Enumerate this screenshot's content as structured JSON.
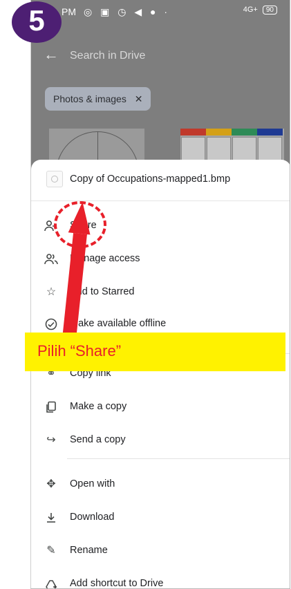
{
  "status_bar": {
    "time": "PM",
    "icons": "◎ ▣ ◷ ◀ ●  ·",
    "network": "4G+",
    "battery": "90"
  },
  "search": {
    "placeholder": "Search in Drive"
  },
  "filter_chip": {
    "label": "Photos & images",
    "close": "✕"
  },
  "sheet": {
    "file_name": "Copy of Occupations-mapped1.bmp",
    "items": [
      {
        "label": "Share",
        "icon": "person-add-icon"
      },
      {
        "label": "Manage access",
        "icon": "people-icon"
      },
      {
        "label": "Add to Starred",
        "icon": "star-icon"
      },
      {
        "label": "Make available offline",
        "icon": "offline-icon"
      },
      {
        "label": "Copy link",
        "icon": "link-icon"
      },
      {
        "label": "Make a copy",
        "icon": "copy-icon"
      },
      {
        "label": "Send a copy",
        "icon": "send-icon"
      },
      {
        "label": "Open with",
        "icon": "open-with-icon"
      },
      {
        "label": "Download",
        "icon": "download-icon"
      },
      {
        "label": "Rename",
        "icon": "rename-icon"
      },
      {
        "label": "Add shortcut to Drive",
        "icon": "shortcut-icon"
      }
    ]
  },
  "annotation": {
    "step_number": "5",
    "callout": "Pilih “Share”",
    "accent_color": "#e8202a",
    "highlight_color": "#fff200",
    "badge_color": "#4d1f73"
  }
}
